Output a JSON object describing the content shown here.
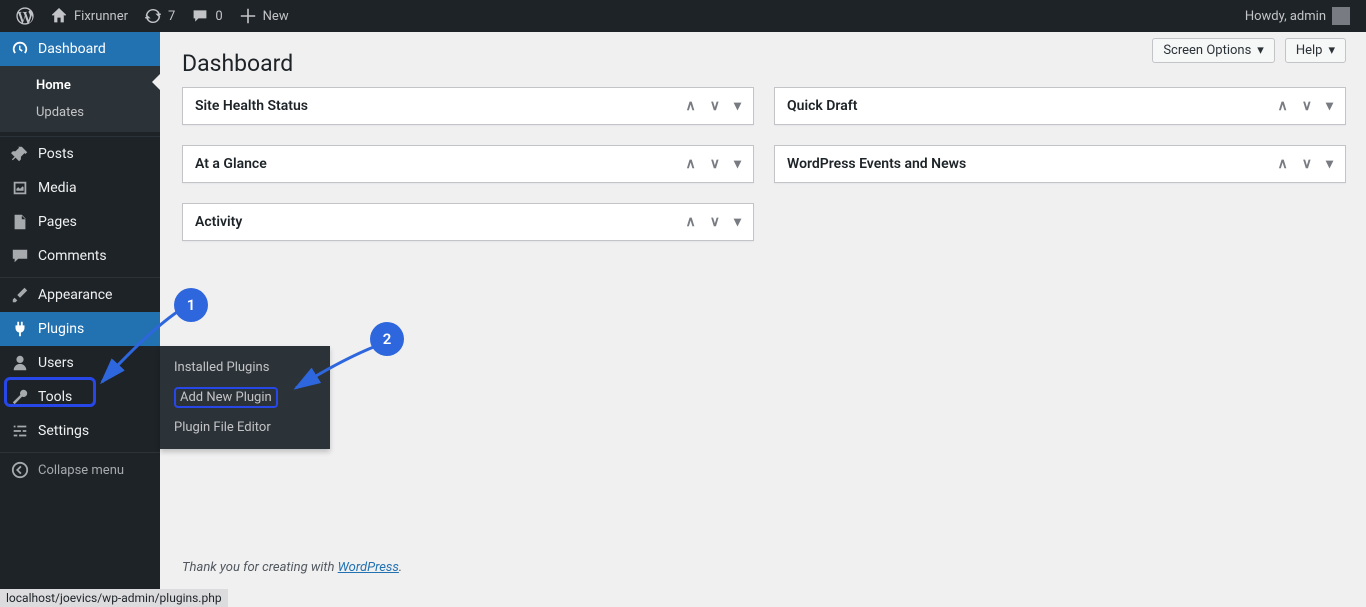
{
  "adminbar": {
    "site_name": "Fixrunner",
    "updates_count": "7",
    "comments_count": "0",
    "new_label": "New",
    "greeting": "Howdy, admin"
  },
  "sidebar": {
    "dashboard": "Dashboard",
    "sub_home": "Home",
    "sub_updates": "Updates",
    "posts": "Posts",
    "media": "Media",
    "pages": "Pages",
    "comments": "Comments",
    "appearance": "Appearance",
    "plugins": "Plugins",
    "users": "Users",
    "tools": "Tools",
    "settings": "Settings",
    "collapse": "Collapse menu"
  },
  "flyout": {
    "installed": "Installed Plugins",
    "add_new": "Add New Plugin",
    "editor": "Plugin File Editor"
  },
  "topright": {
    "screen_options": "Screen Options",
    "help": "Help"
  },
  "page": {
    "title": "Dashboard"
  },
  "widgets": {
    "site_health": "Site Health Status",
    "at_a_glance": "At a Glance",
    "activity": "Activity",
    "quick_draft": "Quick Draft",
    "events_news": "WordPress Events and News"
  },
  "footer": {
    "pre": "Thank you for creating with ",
    "link": "WordPress",
    "post": "."
  },
  "statusbar": {
    "url": "localhost/joevics/wp-admin/plugins.php"
  },
  "annotations": {
    "one": "1",
    "two": "2"
  }
}
